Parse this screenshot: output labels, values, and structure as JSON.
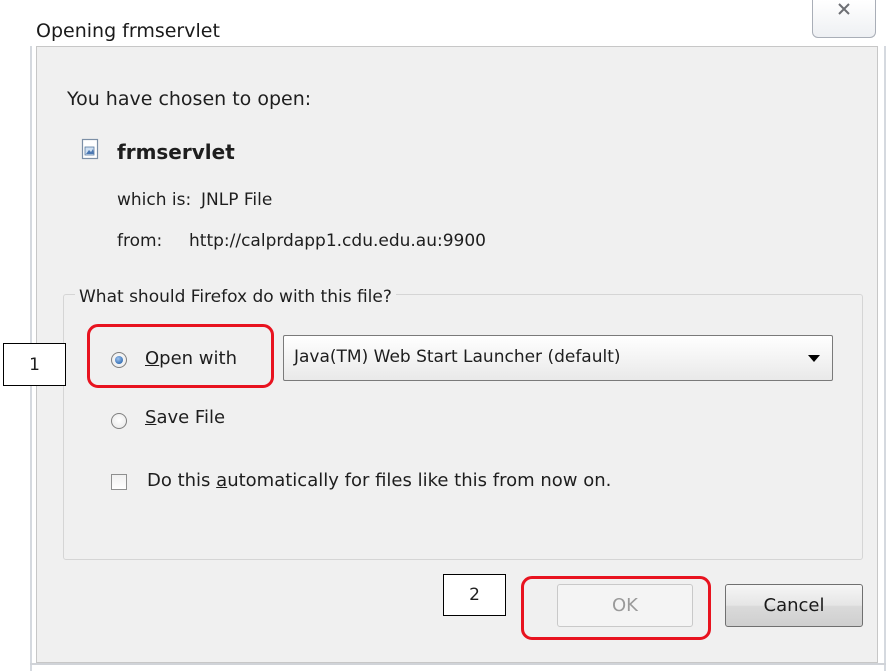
{
  "window": {
    "title": "Opening frmservlet",
    "close_icon": "close-icon"
  },
  "dialog": {
    "intro": "You have chosen to open:",
    "file_icon": "document-icon",
    "file_name": "frmservlet",
    "type_label": "which is:",
    "type_value": "JNLP File",
    "from_label": "from:",
    "from_value": "http://calprdapp1.cdu.edu.au:9900",
    "group_title": "What should Firefox do with this file?",
    "open_with": {
      "mnemonic": "O",
      "rest": "pen with",
      "selected": true
    },
    "application": "Java(TM) Web Start Launcher (default)",
    "save_file": {
      "mnemonic": "S",
      "rest": "ave File",
      "selected": false
    },
    "auto": {
      "before": "Do this ",
      "mnemonic": "a",
      "after": "utomatically for files like this from now on.",
      "checked": false
    },
    "ok_label": "OK",
    "cancel_label": "Cancel"
  },
  "annotations": {
    "callout1": "1",
    "callout2": "2",
    "highlight_color": "#e8131f"
  }
}
